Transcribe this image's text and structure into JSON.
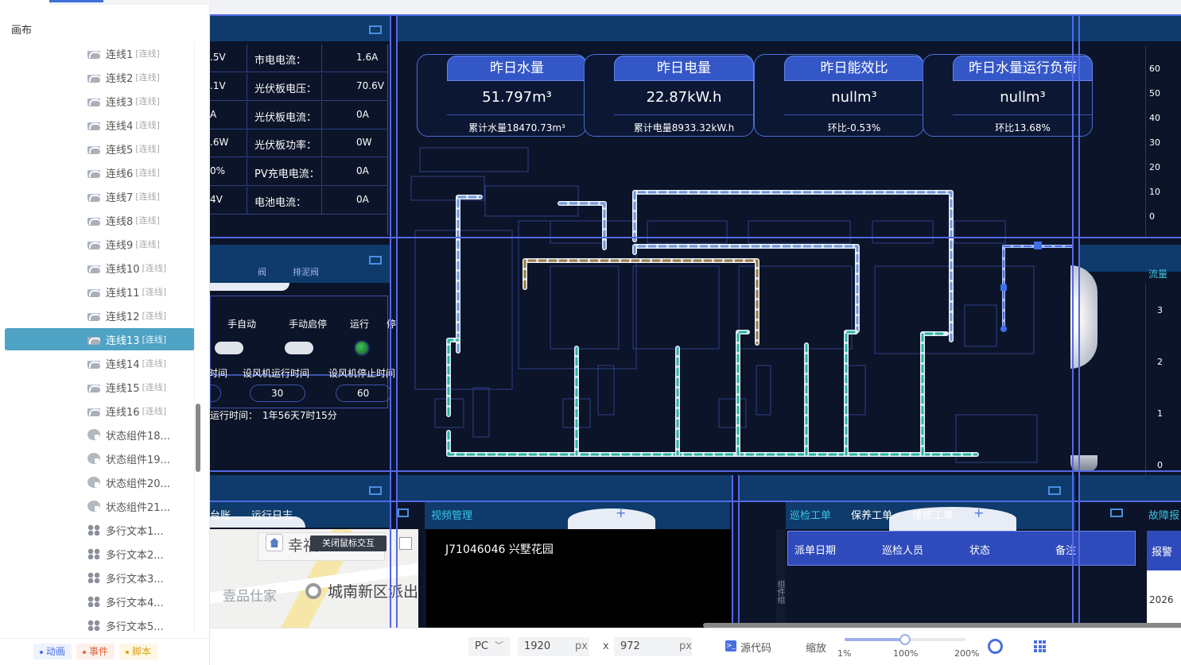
{
  "left_panel": {
    "section_title": "画布",
    "layers": [
      {
        "name": "连线1",
        "tag": "[连线]",
        "icon": "line-icon"
      },
      {
        "name": "连线2",
        "tag": "[连线]",
        "icon": "line-icon"
      },
      {
        "name": "连线3",
        "tag": "[连线]",
        "icon": "line-icon"
      },
      {
        "name": "连线4",
        "tag": "[连线]",
        "icon": "line-icon"
      },
      {
        "name": "连线5",
        "tag": "[连线]",
        "icon": "line-icon"
      },
      {
        "name": "连线6",
        "tag": "[连线]",
        "icon": "line-icon"
      },
      {
        "name": "连线7",
        "tag": "[连线]",
        "icon": "line-icon"
      },
      {
        "name": "连线8",
        "tag": "[连线]",
        "icon": "line-icon"
      },
      {
        "name": "连线9",
        "tag": "[连线]",
        "icon": "line-icon"
      },
      {
        "name": "连线10",
        "tag": "[连线]",
        "icon": "line-icon"
      },
      {
        "name": "连线11",
        "tag": "[连线]",
        "icon": "line-icon"
      },
      {
        "name": "连线12",
        "tag": "[连线]",
        "icon": "line-icon"
      },
      {
        "name": "连线13",
        "tag": "[连线]",
        "icon": "line-icon",
        "selected": true
      },
      {
        "name": "连线14",
        "tag": "[连线]",
        "icon": "line-icon"
      },
      {
        "name": "连线15",
        "tag": "[连线]",
        "icon": "line-icon"
      },
      {
        "name": "连线16",
        "tag": "[连线]",
        "icon": "line-icon"
      },
      {
        "name": "状态组件18...",
        "tag": "",
        "icon": "status-icon"
      },
      {
        "name": "状态组件19...",
        "tag": "",
        "icon": "status-icon"
      },
      {
        "name": "状态组件20...",
        "tag": "",
        "icon": "status-icon"
      },
      {
        "name": "状态组件21...",
        "tag": "",
        "icon": "status-icon"
      },
      {
        "name": "多行文本1...",
        "tag": "",
        "icon": "text-icon"
      },
      {
        "name": "多行文本2...",
        "tag": "",
        "icon": "text-icon"
      },
      {
        "name": "多行文本3...",
        "tag": "",
        "icon": "text-icon"
      },
      {
        "name": "多行文本4...",
        "tag": "",
        "icon": "text-icon"
      },
      {
        "name": "多行文本5...",
        "tag": "",
        "icon": "text-icon"
      }
    ],
    "tabs": [
      {
        "label": "动画",
        "color": "#4a6ee0",
        "bg": "#eef2fd"
      },
      {
        "label": "事件",
        "color": "#e0643a",
        "bg": "#fdf0ea"
      },
      {
        "label": "脚本",
        "color": "#d9a216",
        "bg": "#fdf7e4"
      }
    ]
  },
  "canvas": {
    "left_metrics": [
      {
        "left_value": ".5V",
        "label": "市电电流：",
        "value": "1.6A"
      },
      {
        "left_value": ".1V",
        "label": "光伏板电压：",
        "value": "70.6V"
      },
      {
        "left_value": "A",
        "label": "光伏板电流：",
        "value": "0A"
      },
      {
        "left_value": ".6W",
        "label": "光伏板功率：",
        "value": "0W"
      },
      {
        "left_value": "0%",
        "label": "PV充电电流：",
        "value": "0A"
      },
      {
        "left_value": "4V",
        "label": "电池电流：",
        "value": "0A"
      }
    ],
    "control": {
      "tab_fragments": [
        "阀",
        "排泥阀"
      ],
      "headers": [
        "手自动",
        "手动启停",
        "运行",
        "停"
      ],
      "time_labels": [
        "时间",
        "设风机运行时间",
        "设风机停止时间"
      ],
      "time_values": [
        "30",
        "60"
      ],
      "runtime_label": "运行时间：",
      "runtime_value": "1年56天7时15分"
    },
    "stats": [
      {
        "title": "昨日水量",
        "value": "51.797m³",
        "sub": "累计水量18470.73m³"
      },
      {
        "title": "昨日电量",
        "value": "22.87kW.h",
        "sub": "累计电量8933.32kW.h"
      },
      {
        "title": "昨日能效比",
        "value": "nullm³",
        "sub": "环比-0.53%"
      },
      {
        "title": "昨日水量运行负荷",
        "value": "nullm³",
        "sub": "环比13.68%"
      }
    ],
    "right_axis_top": [
      "60",
      "50",
      "40",
      "30",
      "20",
      "10",
      "0"
    ],
    "right_label_top": "流量",
    "right_axis_bottom": [
      "3",
      "2",
      "1",
      "0"
    ],
    "bottom_left": {
      "tabs": [
        "台账",
        "运行日志"
      ],
      "map_btn": "关闭鼠标交互",
      "map_labels": [
        "幸福",
        "壹品仕家",
        "城南新区派出"
      ]
    },
    "video": {
      "title": "视频管理",
      "channel": "J71046046   兴墅花园"
    },
    "workorder": {
      "tabs": [
        "巡检工单",
        "保养工单",
        "维修工单"
      ],
      "columns": [
        "派单日期",
        "巡检人员",
        "状态",
        "备注"
      ],
      "side_text": "组件组"
    },
    "alarm": {
      "title": "故障报",
      "header": "报警",
      "date": "2026"
    }
  },
  "bottom_bar": {
    "device": "PC",
    "width": "1920",
    "height": "972",
    "unit": "px",
    "times": "x",
    "source_label": "源代码",
    "zoom_label": "缩放",
    "zoom_ticks": [
      "1%",
      "100%",
      "200%"
    ],
    "zoom_level": 0.5
  },
  "colors": {
    "board_bg": "#0b1428",
    "accent": "#3457c8",
    "selected_layer": "#4fa3c4",
    "panel_header": "#0e3b6b"
  }
}
